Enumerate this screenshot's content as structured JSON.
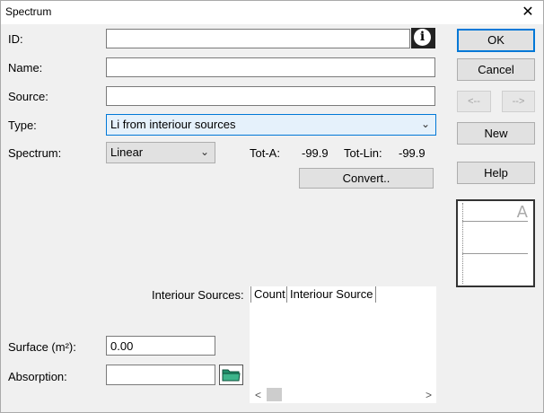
{
  "window": {
    "title": "Spectrum",
    "close_glyph": "✕"
  },
  "fields": {
    "id": {
      "label": "ID:",
      "value": ""
    },
    "name": {
      "label": "Name:",
      "value": ""
    },
    "source": {
      "label": "Source:",
      "value": ""
    },
    "type": {
      "label": "Type:",
      "value": "Li from interiour sources"
    },
    "spectrum": {
      "label": "Spectrum:",
      "value": "Linear"
    },
    "surface": {
      "label": "Surface (m²):",
      "value": "0.00"
    },
    "absorption": {
      "label": "Absorption:",
      "value": ""
    }
  },
  "totals": {
    "tot_a_label": "Tot-A:",
    "tot_a_value": "-99.9",
    "tot_lin_label": "Tot-Lin:",
    "tot_lin_value": "-99.9"
  },
  "buttons": {
    "ok": "OK",
    "cancel": "Cancel",
    "prev": "<--",
    "next": "-->",
    "new": "New",
    "help": "Help",
    "convert": "Convert.."
  },
  "interior_sources": {
    "label": "Interiour Sources:",
    "columns": [
      "Count",
      "Interiour Source"
    ],
    "scroll_left": "<",
    "scroll_right": ">"
  },
  "preview": {
    "letter": "A"
  },
  "icons": {
    "info": "info-icon",
    "folder": "folder-icon",
    "dropdown": "chevron-down-icon"
  },
  "colors": {
    "default_button_border": "#0078d7",
    "folder_green": "#1f8f6a"
  }
}
